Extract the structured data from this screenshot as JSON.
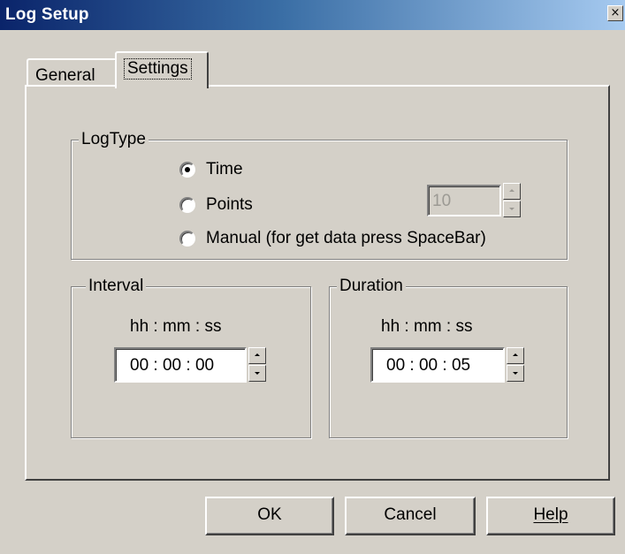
{
  "window": {
    "title": "Log Setup",
    "close_glyph": "×"
  },
  "tabs": [
    {
      "label": "General",
      "selected": false
    },
    {
      "label": "Settings",
      "selected": true
    }
  ],
  "logtype": {
    "legend": "LogType",
    "options": [
      {
        "label": "Time",
        "checked": true
      },
      {
        "label": "Points",
        "checked": false
      },
      {
        "label": "Manual  (for get data press SpaceBar)",
        "checked": false
      }
    ],
    "points_value": "10"
  },
  "interval": {
    "legend": "Interval",
    "format": "hh : mm : ss",
    "value": "00 : 00 : 00"
  },
  "duration": {
    "legend": "Duration",
    "format": "hh : mm : ss",
    "value": "00 : 00 : 05"
  },
  "buttons": {
    "ok": "OK",
    "cancel": "Cancel",
    "help": "Help"
  },
  "icons": {
    "close": "close-icon",
    "spin_up": "spin-up-icon",
    "spin_down": "spin-down-icon"
  }
}
